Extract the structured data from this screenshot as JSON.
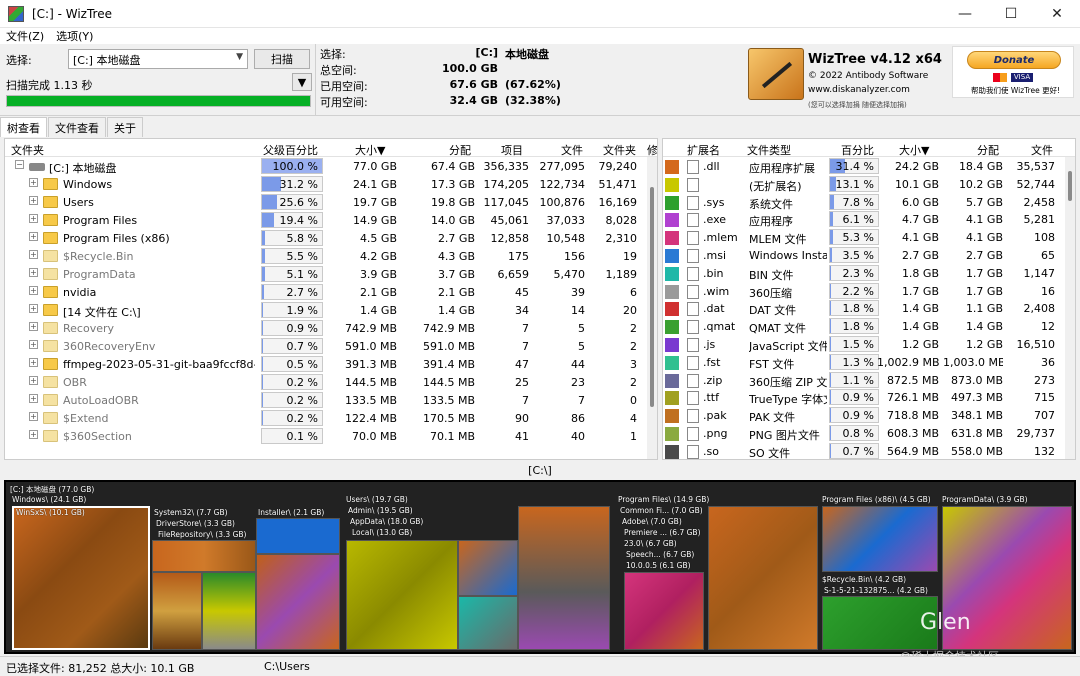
{
  "window": {
    "title": "[C:] - WizTree"
  },
  "menu": {
    "file": "文件(Z)",
    "options": "选项(Y)"
  },
  "scan": {
    "select_label": "选择:",
    "drive_value": "[C:] 本地磁盘",
    "scan_button": "扫描",
    "status": "扫描完成 1.13 秒",
    "progress": 1.0
  },
  "summary": {
    "rows": [
      {
        "label": "选择:",
        "v1": "[C:]",
        "v2": "本地磁盘"
      },
      {
        "label": "总空间:",
        "v1": "100.0 GB",
        "v2": ""
      },
      {
        "label": "已用空间:",
        "v1": "67.6 GB",
        "v2": "(67.62%)"
      },
      {
        "label": "可用空间:",
        "v1": "32.4 GB",
        "v2": "(32.38%)"
      }
    ]
  },
  "logo": {
    "name": "WizTree v4.12 x64",
    "copyright": "© 2022 Antibody Software",
    "url": "www.diskanalyzer.com",
    "note": "(您可以选择加捐 随便选择加捐)"
  },
  "donate": {
    "button": "Donate",
    "caption": "帮助我们使 WizTree 更好!"
  },
  "tabs": [
    "树查看",
    "文件查看",
    "关于"
  ],
  "tree": {
    "headers": {
      "folder": "文件夹",
      "parent_pct": "父级百分比",
      "size": "大小▼",
      "alloc": "分配",
      "items": "项目",
      "files": "文件",
      "folders": "文件夹",
      "mod": "修"
    },
    "root": {
      "name": "[C:] 本地磁盘",
      "pct": "100.0 %",
      "pct_val": 1.0,
      "size": "77.0 GB",
      "alloc": "67.4 GB",
      "items": "356,335",
      "files": "277,095",
      "folders": "79,240"
    },
    "rows": [
      {
        "name": "Windows",
        "pct": "31.2 %",
        "pct_val": 0.312,
        "size": "24.1 GB",
        "alloc": "17.3 GB",
        "items": "174,205",
        "files": "122,734",
        "folders": "51,471",
        "icon": "folder"
      },
      {
        "name": "Users",
        "pct": "25.6 %",
        "pct_val": 0.256,
        "size": "19.7 GB",
        "alloc": "19.8 GB",
        "items": "117,045",
        "files": "100,876",
        "folders": "16,169",
        "icon": "folder"
      },
      {
        "name": "Program Files",
        "pct": "19.4 %",
        "pct_val": 0.194,
        "size": "14.9 GB",
        "alloc": "14.0 GB",
        "items": "45,061",
        "files": "37,033",
        "folders": "8,028",
        "icon": "folder"
      },
      {
        "name": "Program Files (x86)",
        "pct": "5.8 %",
        "pct_val": 0.058,
        "size": "4.5 GB",
        "alloc": "2.7 GB",
        "items": "12,858",
        "files": "10,548",
        "folders": "2,310",
        "icon": "folder"
      },
      {
        "name": "$Recycle.Bin",
        "pct": "5.5 %",
        "pct_val": 0.055,
        "size": "4.2 GB",
        "alloc": "4.3 GB",
        "items": "175",
        "files": "156",
        "folders": "19",
        "icon": "gear"
      },
      {
        "name": "ProgramData",
        "pct": "5.1 %",
        "pct_val": 0.051,
        "size": "3.9 GB",
        "alloc": "3.7 GB",
        "items": "6,659",
        "files": "5,470",
        "folders": "1,189",
        "icon": "ghost"
      },
      {
        "name": "nvidia",
        "pct": "2.7 %",
        "pct_val": 0.027,
        "size": "2.1 GB",
        "alloc": "2.1 GB",
        "items": "45",
        "files": "39",
        "folders": "6",
        "icon": "folder"
      },
      {
        "name": "[14 文件在 C:\\]",
        "pct": "1.9 %",
        "pct_val": 0.019,
        "size": "1.4 GB",
        "alloc": "1.4 GB",
        "items": "34",
        "files": "14",
        "folders": "20",
        "icon": "folder"
      },
      {
        "name": "Recovery",
        "pct": "0.9 %",
        "pct_val": 0.009,
        "size": "742.9 MB",
        "alloc": "742.9 MB",
        "items": "7",
        "files": "5",
        "folders": "2",
        "icon": "ghost"
      },
      {
        "name": "360RecoveryEnv",
        "pct": "0.7 %",
        "pct_val": 0.007,
        "size": "591.0 MB",
        "alloc": "591.0 MB",
        "items": "7",
        "files": "5",
        "folders": "2",
        "icon": "ghost"
      },
      {
        "name": "ffmpeg-2023-05-31-git-baa9fccf8d-full_b",
        "pct": "0.5 %",
        "pct_val": 0.005,
        "size": "391.3 MB",
        "alloc": "391.4 MB",
        "items": "47",
        "files": "44",
        "folders": "3",
        "icon": "folder"
      },
      {
        "name": "OBR",
        "pct": "0.2 %",
        "pct_val": 0.002,
        "size": "144.5 MB",
        "alloc": "144.5 MB",
        "items": "25",
        "files": "23",
        "folders": "2",
        "icon": "ghost"
      },
      {
        "name": "AutoLoadOBR",
        "pct": "0.2 %",
        "pct_val": 0.002,
        "size": "133.5 MB",
        "alloc": "133.5 MB",
        "items": "7",
        "files": "7",
        "folders": "0",
        "icon": "gear"
      },
      {
        "name": "$Extend",
        "pct": "0.2 %",
        "pct_val": 0.002,
        "size": "122.4 MB",
        "alloc": "170.5 MB",
        "items": "90",
        "files": "86",
        "folders": "4",
        "icon": "gear"
      },
      {
        "name": "$360Section",
        "pct": "0.1 %",
        "pct_val": 0.001,
        "size": "70.0 MB",
        "alloc": "70.1 MB",
        "items": "41",
        "files": "40",
        "folders": "1",
        "icon": "gear"
      }
    ]
  },
  "ext": {
    "headers": {
      "ext": "扩展名",
      "type": "文件类型",
      "pct": "百分比",
      "size": "大小▼",
      "alloc": "分配",
      "files": "文件"
    },
    "rows": [
      {
        "color": "#d4691c",
        "ext": ".dll",
        "type": "应用程序扩展",
        "pct": "31.4 %",
        "pct_val": 0.314,
        "size": "24.2 GB",
        "alloc": "18.4 GB",
        "files": "35,537"
      },
      {
        "color": "#c8c800",
        "ext": "",
        "type": "(无扩展名)",
        "pct": "13.1 %",
        "pct_val": 0.131,
        "size": "10.1 GB",
        "alloc": "10.2 GB",
        "files": "52,744"
      },
      {
        "color": "#2da02d",
        "ext": ".sys",
        "type": "系统文件",
        "pct": "7.8 %",
        "pct_val": 0.078,
        "size": "6.0 GB",
        "alloc": "5.7 GB",
        "files": "2,458"
      },
      {
        "color": "#b040d0",
        "ext": ".exe",
        "type": "应用程序",
        "pct": "6.1 %",
        "pct_val": 0.061,
        "size": "4.7 GB",
        "alloc": "4.1 GB",
        "files": "5,281"
      },
      {
        "color": "#d4347c",
        "ext": ".mlem",
        "type": "MLEM 文件",
        "pct": "5.3 %",
        "pct_val": 0.053,
        "size": "4.1 GB",
        "alloc": "4.1 GB",
        "files": "108"
      },
      {
        "color": "#2a7ad4",
        "ext": ".msi",
        "type": "Windows Installe",
        "pct": "3.5 %",
        "pct_val": 0.035,
        "size": "2.7 GB",
        "alloc": "2.7 GB",
        "files": "65"
      },
      {
        "color": "#1fb8a8",
        "ext": ".bin",
        "type": "BIN 文件",
        "pct": "2.3 %",
        "pct_val": 0.023,
        "size": "1.8 GB",
        "alloc": "1.7 GB",
        "files": "1,147"
      },
      {
        "color": "#9a9a9a",
        "ext": ".wim",
        "type": "360压缩",
        "pct": "2.2 %",
        "pct_val": 0.022,
        "size": "1.7 GB",
        "alloc": "1.7 GB",
        "files": "16"
      },
      {
        "color": "#d03030",
        "ext": ".dat",
        "type": "DAT 文件",
        "pct": "1.8 %",
        "pct_val": 0.018,
        "size": "1.4 GB",
        "alloc": "1.1 GB",
        "files": "2,408"
      },
      {
        "color": "#3aa030",
        "ext": ".qmat",
        "type": "QMAT 文件",
        "pct": "1.8 %",
        "pct_val": 0.018,
        "size": "1.4 GB",
        "alloc": "1.4 GB",
        "files": "12"
      },
      {
        "color": "#7a3ad0",
        "ext": ".js",
        "type": "JavaScript 文件",
        "pct": "1.5 %",
        "pct_val": 0.015,
        "size": "1.2 GB",
        "alloc": "1.2 GB",
        "files": "16,510"
      },
      {
        "color": "#30c090",
        "ext": ".fst",
        "type": "FST 文件",
        "pct": "1.3 %",
        "pct_val": 0.013,
        "size": "1,002.9 MB",
        "alloc": "1,003.0 MB",
        "files": "36"
      },
      {
        "color": "#6a6a9a",
        "ext": ".zip",
        "type": "360压缩 ZIP 文件",
        "pct": "1.1 %",
        "pct_val": 0.011,
        "size": "872.5 MB",
        "alloc": "873.0 MB",
        "files": "273"
      },
      {
        "color": "#a0a020",
        "ext": ".ttf",
        "type": "TrueType 字体文",
        "pct": "0.9 %",
        "pct_val": 0.009,
        "size": "726.1 MB",
        "alloc": "497.3 MB",
        "files": "715"
      },
      {
        "color": "#c07020",
        "ext": ".pak",
        "type": "PAK 文件",
        "pct": "0.9 %",
        "pct_val": 0.009,
        "size": "718.8 MB",
        "alloc": "348.1 MB",
        "files": "707"
      },
      {
        "color": "#8aaa40",
        "ext": ".png",
        "type": "PNG 图片文件",
        "pct": "0.8 %",
        "pct_val": 0.008,
        "size": "608.3 MB",
        "alloc": "631.8 MB",
        "files": "29,737"
      },
      {
        "color": "#4a4a4a",
        "ext": ".so",
        "type": "SO 文件",
        "pct": "0.7 %",
        "pct_val": 0.007,
        "size": "564.9 MB",
        "alloc": "558.0 MB",
        "files": "132"
      }
    ]
  },
  "path": "[C:\\]",
  "treemap_labels": {
    "root": "[C:] 本地磁盘  (77.0 GB)",
    "windows": "Windows\\ (24.1 GB)",
    "winsxs": "WinSxS\\ (10.1 GB)",
    "system32": "System32\\ (7.7 GB)",
    "driverstore": "DriverStore\\ (3.3 GB)",
    "filerepo": "FileRepository\\ (3.3 GB)",
    "installer": "Installer\\ (2.1 GB)",
    "users": "Users\\ (19.7 GB)",
    "admin": "Admin\\ (19.5 GB)",
    "appdata": "AppData\\ (18.0 GB)",
    "local": "Local\\ (13.0 GB)",
    "programfiles": "Program Files\\ (14.9 GB)",
    "commonfi": "Common Fi... (7.0 GB)",
    "adobe": "Adobe\\ (7.0 GB)",
    "premiere": "Premiere ... (6.7 GB)",
    "v23": "23.0\\ (6.7 GB)",
    "speech": "Speech... (6.7 GB)",
    "v10": "10.0.0.5 (6.1 GB)",
    "pfx86": "Program Files (x86)\\ (4.5 GB)",
    "programdata": "ProgramData\\ (3.9 GB)",
    "recycle": "$Recycle.Bin\\ (4.2 GB)",
    "s15": "S-1-5-21-132875... (4.2 GB)"
  },
  "status": {
    "selected": "已选择文件: 81,252  总大小: 10.1 GB",
    "path": "C:\\Users"
  },
  "watermark": {
    "main": "Glen",
    "sub": "@稀土掘金技术社区"
  }
}
